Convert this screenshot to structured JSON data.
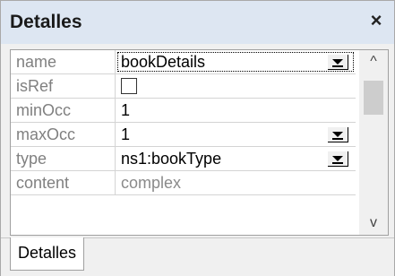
{
  "window": {
    "title": "Detalles",
    "close_glyph": "×"
  },
  "properties": [
    {
      "name": "name",
      "value": "bookDetails",
      "has_dropdown": true,
      "selected": true
    },
    {
      "name": "isRef",
      "value": "",
      "type": "checkbox",
      "checked": false
    },
    {
      "name": "minOcc",
      "value": "1"
    },
    {
      "name": "maxOcc",
      "value": "1",
      "has_dropdown": true
    },
    {
      "name": "type",
      "value": "ns1:bookType",
      "has_dropdown": true
    },
    {
      "name": "content",
      "value": "complex",
      "readonly": true
    }
  ],
  "scrollbar": {
    "up_glyph": "^",
    "down_glyph": "v"
  },
  "tabs": [
    {
      "label": "Detalles",
      "active": true
    }
  ],
  "colors": {
    "titlebar_bg": "#dde6f2",
    "panel_bg": "#f0f0f0",
    "label_text": "#808080"
  }
}
